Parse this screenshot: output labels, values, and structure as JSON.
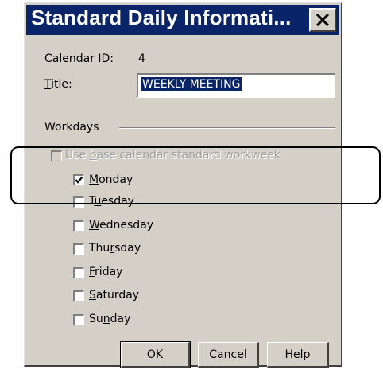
{
  "dialog": {
    "title": "Standard Daily Informati...",
    "calendar_id_label": "Calendar ID:",
    "calendar_id_value": "4",
    "title_label": "Title:",
    "title_value": "WEEKLY MEETING",
    "workdays_label": "Workdays",
    "use_base_label": "Use base calendar standard workweek",
    "days": [
      {
        "label": "Monday",
        "checked": true
      },
      {
        "label": "Tuesday",
        "checked": false
      },
      {
        "label": "Wednesday",
        "checked": false
      },
      {
        "label": "Thursday",
        "checked": false
      },
      {
        "label": "Friday",
        "checked": false
      },
      {
        "label": "Saturday",
        "checked": false
      },
      {
        "label": "Sunday",
        "checked": false
      }
    ],
    "buttons": {
      "ok": "OK",
      "cancel": "Cancel",
      "help": "Help"
    }
  }
}
